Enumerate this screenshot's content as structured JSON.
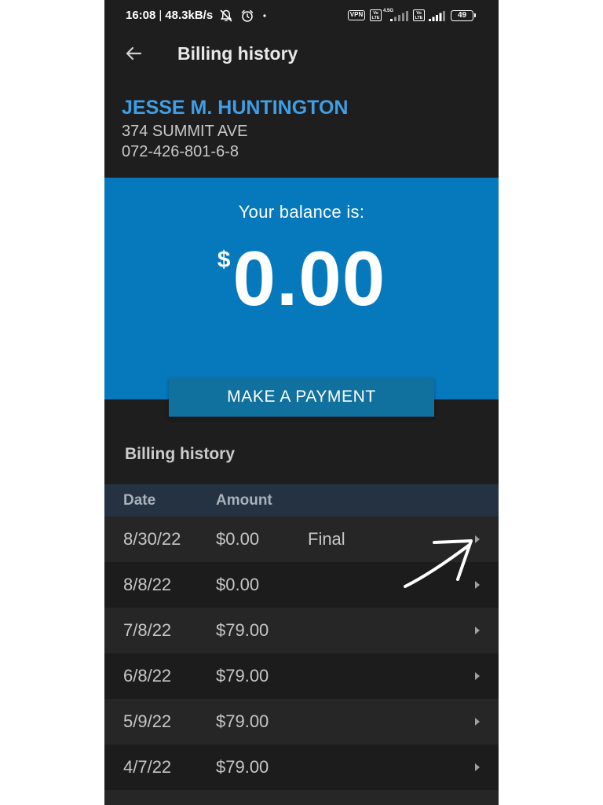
{
  "status_bar": {
    "time": "16:08",
    "separator": "|",
    "network_speed": "48.3kB/s",
    "vpn_label": "VPN",
    "volte_top": "Vo",
    "volte_bottom": "LTE",
    "network_type": "4.5G",
    "battery_level": "49",
    "icons": {
      "mute": "muted-bell-icon",
      "alarm": "alarm-icon",
      "notification": "notification-dot-icon",
      "vpn": "vpn-icon",
      "volte": "volte-icon",
      "signal": "signal-icon",
      "battery": "battery-icon"
    }
  },
  "app_bar": {
    "title": "Billing history",
    "back_icon": "back-arrow-icon"
  },
  "account": {
    "name": "JESSE M. HUNTINGTON",
    "address": "374 SUMMIT AVE",
    "account_number": "072-426-801-6-8"
  },
  "balance": {
    "label": "Your balance is:",
    "currency_symbol": "$",
    "amount": "0.00"
  },
  "payment_button": {
    "label": "MAKE A PAYMENT"
  },
  "billing_history": {
    "title": "Billing history",
    "columns": {
      "date": "Date",
      "amount": "Amount"
    },
    "row_icon": "chevron-right-icon",
    "rows": [
      {
        "date": "8/30/22",
        "amount": "$0.00",
        "status": "Final"
      },
      {
        "date": "8/8/22",
        "amount": "$0.00"
      },
      {
        "date": "7/8/22",
        "amount": "$79.00"
      },
      {
        "date": "6/8/22",
        "amount": "$79.00"
      },
      {
        "date": "5/9/22",
        "amount": "$79.00"
      },
      {
        "date": "4/7/22",
        "amount": "$79.00"
      }
    ]
  },
  "annotation": {
    "icon": "hand-drawn-arrow-icon"
  },
  "colors": {
    "accent": "#409ee4",
    "balance_background": "#0679bd",
    "payment_button": "#10709e",
    "table_header": "#243242",
    "screen_background": "#1e1e1e",
    "row_light": "#262626",
    "row_dark": "#1c1c1c"
  }
}
